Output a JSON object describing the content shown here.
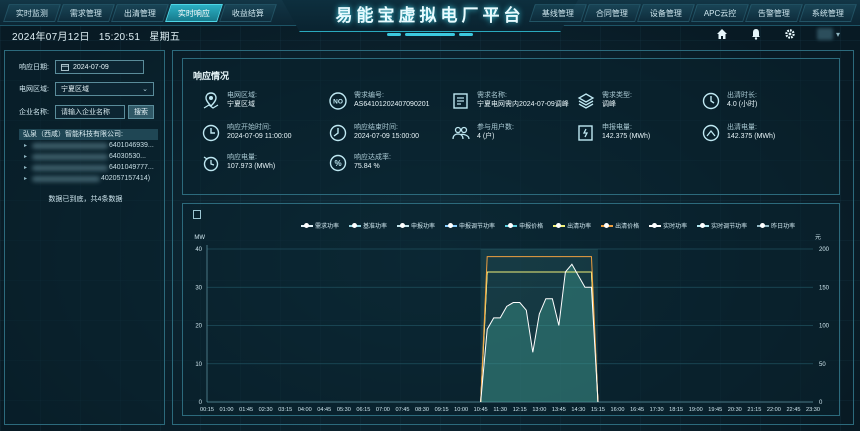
{
  "nav_left": [
    "实时监测",
    "需求管理",
    "出清管理",
    "实时响应",
    "收益结算"
  ],
  "nav_left_active": 3,
  "nav_right": [
    "基线管理",
    "合同管理",
    "设备管理",
    "APC云控",
    "告警管理",
    "系统管理"
  ],
  "title": "易能宝虚拟电厂平台",
  "datetime": {
    "date": "2024年07月12日",
    "time": "15:20:51",
    "weekday": "星期五"
  },
  "top_icons": [
    "home-icon",
    "bell-icon",
    "gear-icon",
    "user-avatar"
  ],
  "filters": {
    "date_label": "响应日期:",
    "date_value": "2024-07-09",
    "area_label": "电网区域:",
    "area_value": "宁夏区域",
    "company_label": "企业名称:",
    "company_placeholder": "请输入企业名称",
    "search_label": "搜索"
  },
  "tree": {
    "root": "弘泉（西咸）智能科技有限公司:",
    "items": [
      "6401046939...",
      "64030530...",
      "6401049777...",
      "402057157414)"
    ],
    "footer": "数据已到底，共4条数据"
  },
  "info": {
    "title": "响应情况",
    "cells": [
      {
        "label": "电网区域:",
        "value": "宁夏区域"
      },
      {
        "label": "需求编号:",
        "value": "AS64101202407090201"
      },
      {
        "label": "需求名称:",
        "value": "宁夏电网需内2024-07-09调峰"
      },
      {
        "label": "需求类型:",
        "value": "调峰"
      },
      {
        "label": "出清时长:",
        "value": "4.0  (小时)"
      },
      {
        "label": "响应开始时间:",
        "value": "2024-07-09 11:00:00"
      },
      {
        "label": "响应结束时间:",
        "value": "2024-07-09 15:00:00"
      },
      {
        "label": "参与用户数:",
        "value": "4  (户)"
      },
      {
        "label": "申报电量:",
        "value": "142.375  (MWh)"
      },
      {
        "label": "出清电量:",
        "value": "142.375  (MWh)"
      },
      {
        "label": "响应电量:",
        "value": "107.973  (MWh)"
      },
      {
        "label": "响应达成率:",
        "value": "75.84 %"
      }
    ]
  },
  "chart_data": {
    "type": "line",
    "ylabel_left": "MW",
    "ylabel_right": "元",
    "ylim_left": [
      0,
      40
    ],
    "ylim_right": [
      0,
      200
    ],
    "yticks_left": [
      0,
      10,
      20,
      30,
      40
    ],
    "yticks_right": [
      0,
      50,
      100,
      150,
      200
    ],
    "x_ticks": [
      "00:15",
      "01:00",
      "01:45",
      "02:30",
      "03:15",
      "04:00",
      "04:45",
      "05:30",
      "06:15",
      "07:00",
      "07:45",
      "08:30",
      "09:15",
      "10:00",
      "10:45",
      "11:30",
      "12:15",
      "13:00",
      "13:45",
      "14:30",
      "15:15",
      "16:00",
      "16:45",
      "17:30",
      "18:15",
      "19:00",
      "19:45",
      "20:30",
      "21:15",
      "22:00",
      "22:45",
      "23:30"
    ],
    "legend": [
      "需求功率",
      "基准功率",
      "申报功率",
      "申报调节功率",
      "申报价格",
      "出清功率",
      "出清价格",
      "实时功率",
      "实时调节功率",
      "昨日功率"
    ],
    "series": [
      {
        "name": "需求功率",
        "color": "#ffffff",
        "x": [
          "10:45",
          "11:00",
          "15:00",
          "15:15"
        ],
        "values": [
          0,
          34,
          34,
          0
        ]
      },
      {
        "name": "出清功率",
        "color": "#f0f07a",
        "x": [
          "10:45",
          "11:00",
          "15:00",
          "15:15"
        ],
        "values": [
          0,
          34,
          34,
          0
        ]
      },
      {
        "name": "出清价格",
        "color": "#f0a040",
        "axis": "right",
        "x": [
          "10:45",
          "11:00",
          "15:00",
          "15:15"
        ],
        "values": [
          0,
          190,
          190,
          0
        ]
      },
      {
        "name": "实时功率",
        "color": "#ffffff",
        "x": [
          "10:45",
          "11:00",
          "11:15",
          "11:30",
          "11:45",
          "12:00",
          "12:15",
          "12:30",
          "12:45",
          "13:00",
          "13:15",
          "13:30",
          "13:45",
          "14:00",
          "14:15",
          "14:30",
          "14:45",
          "15:00",
          "15:15"
        ],
        "values": [
          0,
          19,
          22,
          22,
          25,
          26,
          26,
          24,
          13,
          23,
          27,
          27,
          20,
          34,
          36,
          33,
          30,
          30,
          0
        ]
      }
    ]
  }
}
